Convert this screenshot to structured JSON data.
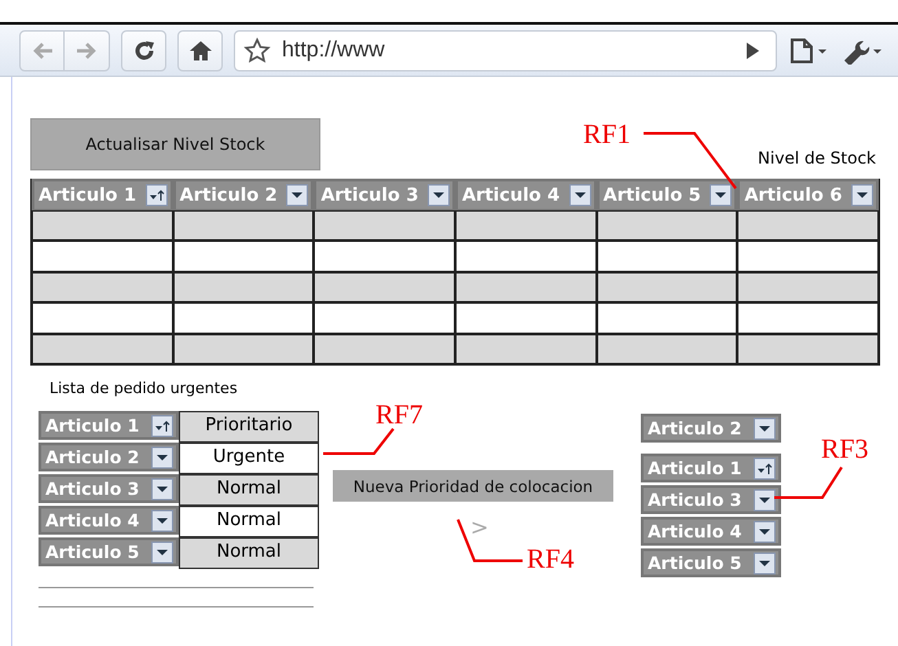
{
  "browser": {
    "url": "http://www"
  },
  "update_button": "Actualisar Nivel Stock",
  "table_caption": "Nivel de Stock",
  "table": {
    "columns": [
      {
        "label": "Articulo 1",
        "kind": "sort"
      },
      {
        "label": "Articulo 2",
        "kind": "dropdown"
      },
      {
        "label": "Articulo 3",
        "kind": "dropdown"
      },
      {
        "label": "Articulo 4",
        "kind": "dropdown"
      },
      {
        "label": "Articulo 5",
        "kind": "dropdown"
      },
      {
        "label": "Articulo 6",
        "kind": "dropdown"
      }
    ],
    "rows": [
      {
        "shaded": true
      },
      {
        "shaded": false
      },
      {
        "shaded": true
      },
      {
        "shaded": false
      },
      {
        "shaded": true
      }
    ]
  },
  "urgent_list": {
    "title": "Lista de pedido urgentes",
    "items": [
      {
        "label": "Articulo 1",
        "kind": "sort",
        "priority": "Prioritario",
        "shaded": true
      },
      {
        "label": "Articulo 2",
        "kind": "dropdown",
        "priority": "Urgente",
        "shaded": false
      },
      {
        "label": "Articulo 3",
        "kind": "dropdown",
        "priority": "Normal",
        "shaded": true
      },
      {
        "label": "Articulo 4",
        "kind": "dropdown",
        "priority": "Normal",
        "shaded": false
      },
      {
        "label": "Articulo 5",
        "kind": "dropdown",
        "priority": "Normal",
        "shaded": true
      }
    ]
  },
  "priority_button": "Nueva Prioridad de colocacion",
  "arrow": ">",
  "reordered_list": [
    {
      "label": "Articulo 2",
      "kind": "dropdown"
    },
    {
      "label": "Articulo 1",
      "kind": "sort"
    },
    {
      "label": "Articulo 3",
      "kind": "dropdown"
    },
    {
      "label": "Articulo 4",
      "kind": "dropdown"
    },
    {
      "label": "Articulo 5",
      "kind": "dropdown"
    }
  ],
  "annotations": [
    {
      "label": "RF1"
    },
    {
      "label": "RF7"
    },
    {
      "label": "RF3"
    },
    {
      "label": "RF4"
    }
  ]
}
